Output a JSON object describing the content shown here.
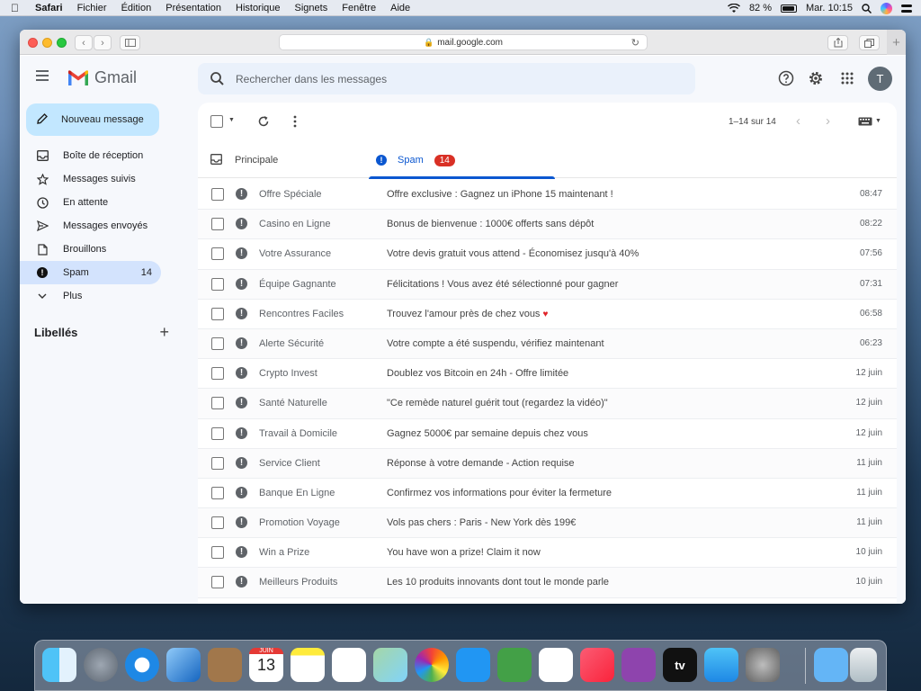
{
  "menubar": {
    "app": "Safari",
    "items": [
      "Fichier",
      "Édition",
      "Présentation",
      "Historique",
      "Signets",
      "Fenêtre",
      "Aide"
    ],
    "battery": "82 %",
    "clock": "Mar. 10:15"
  },
  "browser": {
    "url": "mail.google.com"
  },
  "gmail": {
    "logo_text": "Gmail",
    "search_placeholder": "Rechercher dans les messages",
    "avatar": "T",
    "compose_label": "Nouveau message",
    "nav": [
      {
        "label": "Boîte de réception",
        "icon": "inbox-icon",
        "count": ""
      },
      {
        "label": "Messages suivis",
        "icon": "star-icon",
        "count": ""
      },
      {
        "label": "En attente",
        "icon": "clock-icon",
        "count": ""
      },
      {
        "label": "Messages envoyés",
        "icon": "send-icon",
        "count": ""
      },
      {
        "label": "Brouillons",
        "icon": "draft-icon",
        "count": ""
      },
      {
        "label": "Spam",
        "icon": "spam-icon",
        "count": "14",
        "active": true
      },
      {
        "label": "Plus",
        "icon": "chevron-down-icon",
        "count": ""
      }
    ],
    "labels_title": "Libellés",
    "pagination": "1–14 sur 14",
    "tabs": [
      {
        "label": "Principale"
      },
      {
        "label": "Spam",
        "badge": "14"
      }
    ],
    "emails": [
      {
        "sender": "Offre Spéciale",
        "subject": "Offre exclusive : Gagnez un iPhone 15 maintenant !",
        "time": "08:47"
      },
      {
        "sender": "Casino en Ligne",
        "subject": "Bonus de bienvenue : 1000€ offerts sans dépôt",
        "time": "08:22"
      },
      {
        "sender": "Votre Assurance",
        "subject": "Votre devis gratuit vous attend - Économisez jusqu'à 40%",
        "time": "07:56"
      },
      {
        "sender": "Équipe Gagnante",
        "subject": "Félicitations ! Vous avez été sélectionné pour gagner",
        "time": "07:31"
      },
      {
        "sender": "Rencontres Faciles",
        "subject": "Trouvez l'amour près de chez vous",
        "time": "06:58",
        "heart": "♥"
      },
      {
        "sender": "Alerte Sécurité",
        "subject": "Votre compte a été suspendu, vérifiez maintenant",
        "time": "06:23"
      },
      {
        "sender": "Crypto Invest",
        "subject": "Doublez vos Bitcoin en 24h - Offre limitée",
        "time": "12 juin"
      },
      {
        "sender": "Santé Naturelle",
        "subject": "\"Ce remède naturel guérit tout (regardez la vidéo)\"",
        "time": "12 juin"
      },
      {
        "sender": "Travail à Domicile",
        "subject": "Gagnez 5000€ par semaine depuis chez vous",
        "time": "12 juin"
      },
      {
        "sender": "Service Client",
        "subject": "Réponse à votre demande - Action requise",
        "time": "11 juin"
      },
      {
        "sender": "Banque En Ligne",
        "subject": "Confirmez vos informations pour éviter la fermeture",
        "time": "11 juin"
      },
      {
        "sender": "Promotion Voyage",
        "subject": "Vols pas chers : Paris - New York dès 199€",
        "time": "11 juin"
      },
      {
        "sender": "Win a Prize",
        "subject": "You have won a prize! Claim it now",
        "time": "10 juin"
      },
      {
        "sender": "Meilleurs Produits",
        "subject": "Les 10 produits innovants dont tout le monde parle",
        "time": "10 juin"
      }
    ]
  },
  "dock": {
    "calendar_month": "JUIN",
    "calendar_day": "13",
    "tv_label": "tv"
  },
  "colors": {
    "accent": "#0b57d0",
    "compose": "#c2e7ff",
    "spam_badge": "#d93025",
    "active_nav": "#d3e3fd"
  }
}
